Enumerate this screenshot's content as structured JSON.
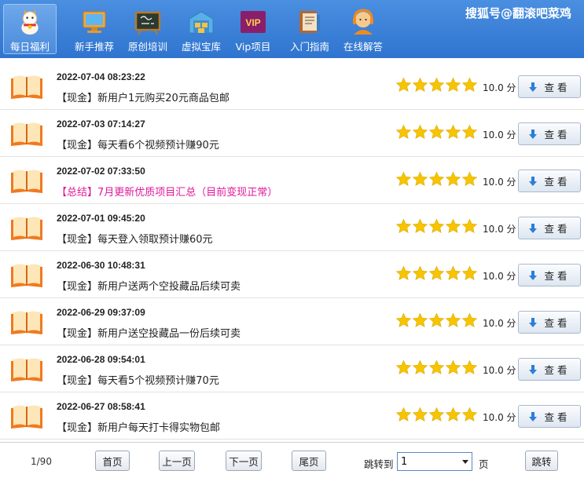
{
  "watermark": "搜狐号@翻滚吧菜鸡",
  "nav": [
    {
      "label": "每日福利",
      "icon": "lucky-cat-icon",
      "active": true
    },
    {
      "label": "新手推荐",
      "icon": "monitor-icon"
    },
    {
      "label": "原创培训",
      "icon": "chalkboard-icon"
    },
    {
      "label": "虚拟宝库",
      "icon": "warehouse-icon"
    },
    {
      "label": "Vip项目",
      "icon": "vip-badge-icon",
      "badge": "VIP"
    },
    {
      "label": "入门指南",
      "icon": "books-icon"
    },
    {
      "label": "在线解答",
      "icon": "support-agent-icon"
    }
  ],
  "items": [
    {
      "date": "2022-07-04 08:23:22",
      "title": "【现金】新用户1元购买20元商品包邮",
      "score": "10.0 分",
      "rating": 5,
      "highlight": false
    },
    {
      "date": "2022-07-03 07:14:27",
      "title": "【现金】每天看6个视频预计赚90元",
      "score": "10.0 分",
      "rating": 5,
      "highlight": false
    },
    {
      "date": "2022-07-02 07:33:50",
      "title": "【总结】7月更新优质项目汇总（目前变现正常）",
      "score": "10.0 分",
      "rating": 5,
      "highlight": true
    },
    {
      "date": "2022-07-01 09:45:20",
      "title": "【现金】每天登入领取预计赚60元",
      "score": "10.0 分",
      "rating": 5,
      "highlight": false
    },
    {
      "date": "2022-06-30 10:48:31",
      "title": "【现金】新用户送两个空投藏品后续可卖",
      "score": "10.0 分",
      "rating": 5,
      "highlight": false
    },
    {
      "date": "2022-06-29 09:37:09",
      "title": "【现金】新用户送空投藏品一份后续可卖",
      "score": "10.0 分",
      "rating": 5,
      "highlight": false
    },
    {
      "date": "2022-06-28 09:54:01",
      "title": "【现金】每天看5个视频预计赚70元",
      "score": "10.0 分",
      "rating": 5,
      "highlight": false
    },
    {
      "date": "2022-06-27 08:58:41",
      "title": "【现金】新用户每天打卡得实物包邮",
      "score": "10.0 分",
      "rating": 5,
      "highlight": false
    }
  ],
  "view_label": "查看",
  "colors": {
    "accent": "#2f74cf",
    "star": "#f6c400",
    "highlight": "#e0189a",
    "book": "#f07a1e"
  },
  "pager": {
    "count": "1/90",
    "first": "首页",
    "prev": "上一页",
    "next": "下一页",
    "last": "尾页",
    "jump_label": "跳转到",
    "jump_value": "1",
    "page_unit": "页",
    "jump_button": "跳转"
  }
}
